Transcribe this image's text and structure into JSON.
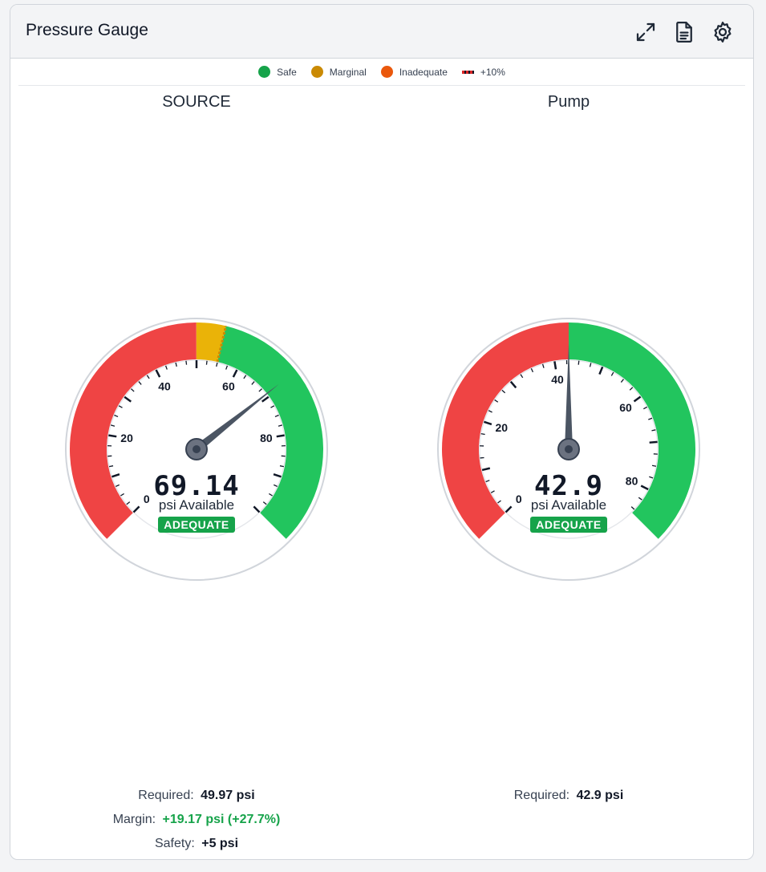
{
  "header": {
    "title": "Pressure Gauge",
    "expand_icon": "expand-icon",
    "report_icon": "document-icon",
    "settings_icon": "gear-icon"
  },
  "legend": [
    {
      "label": "Safe",
      "color": "#16a34a"
    },
    {
      "label": "Marginal",
      "color": "#ca8a04"
    },
    {
      "label": "Inadequate",
      "color": "#ea580c"
    },
    {
      "label": "+10%",
      "style": "dashed-red-black"
    }
  ],
  "gauges": [
    {
      "title": "SOURCE",
      "value": "69.14",
      "value_number": 69.14,
      "unit_label": "psi Available",
      "status": "ADEQUATE",
      "scale_min": 0,
      "scale_max": 100,
      "tick_labels": [
        "0",
        "20",
        "40",
        "60",
        "80"
      ],
      "zones": [
        {
          "type": "inadequate",
          "from": 0,
          "to": 49.97
        },
        {
          "type": "marginal",
          "from": 49.97,
          "to": 54.97
        },
        {
          "type": "safe",
          "from": 54.97,
          "to": 100
        }
      ],
      "plus10_marker": 54.97,
      "stats": [
        {
          "label": "Required:",
          "value": "49.97 psi",
          "tone": "default"
        },
        {
          "label": "Margin:",
          "value": "+19.17 psi (+27.7%)",
          "tone": "green"
        },
        {
          "label": "Safety:",
          "value": "+5 psi",
          "tone": "default"
        }
      ]
    },
    {
      "title": "Pump",
      "value": "42.9",
      "value_number": 42.9,
      "unit_label": "psi Available",
      "status": "ADEQUATE",
      "scale_min": 0,
      "scale_max": 85.8,
      "tick_labels": [
        "0",
        "20",
        "40",
        "60",
        "80"
      ],
      "zones": [
        {
          "type": "inadequate",
          "from": 0,
          "to": 42.9
        },
        {
          "type": "safe",
          "from": 42.9,
          "to": 85.8
        }
      ],
      "plus10_marker": null,
      "stats": [
        {
          "label": "Required:",
          "value": "42.9 psi",
          "tone": "default"
        }
      ]
    }
  ],
  "colors": {
    "safe": "#22c55e",
    "marginal": "#eab308",
    "inadequate": "#ef4444",
    "needle": "#4b5563",
    "badge": "#16a34a"
  }
}
